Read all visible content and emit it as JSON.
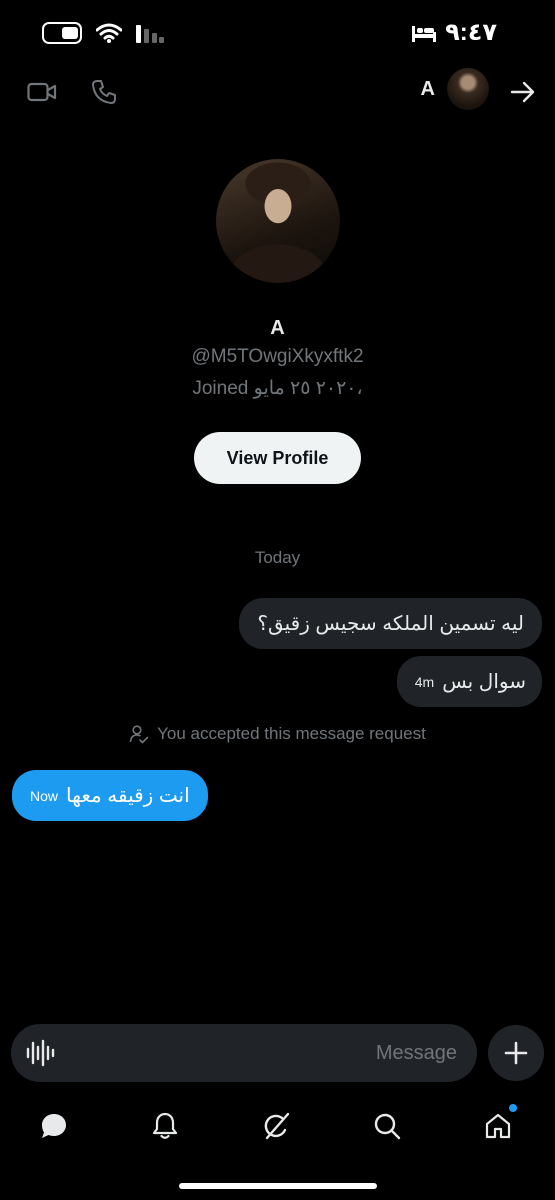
{
  "status_bar": {
    "time": "٩:٤٧",
    "icons": [
      "battery-icon",
      "wifi-icon",
      "signal-icon",
      "bed-icon"
    ]
  },
  "header": {
    "name": "A",
    "icons": [
      "video-call-icon",
      "phone-icon",
      "avatar",
      "forward-arrow-icon"
    ]
  },
  "profile": {
    "name": "A",
    "handle": "@M5TOwgiXkyxftk2",
    "joined": "Joined ٢٠٢٠ ٢٥ مايو،",
    "view_profile_label": "View Profile"
  },
  "conversation": {
    "date_separator": "Today",
    "messages": [
      {
        "text": "ليه تسمين الملكه سجيس زقيق؟",
        "direction": "received"
      },
      {
        "text": "سوال بس",
        "time": "4m",
        "direction": "received"
      },
      {
        "text": "انت زقيقه معها",
        "time": "Now",
        "direction": "sent"
      }
    ],
    "request_note": "You accepted this message request"
  },
  "composer": {
    "placeholder": "Message",
    "value": ""
  },
  "bottom_nav": {
    "items": [
      "messages-icon",
      "notifications-icon",
      "grok-icon",
      "search-icon",
      "home-icon"
    ]
  },
  "colors": {
    "background": "#000000",
    "accent": "#1d9bf0",
    "received_bubble": "#202327",
    "muted_text": "#71767b"
  }
}
